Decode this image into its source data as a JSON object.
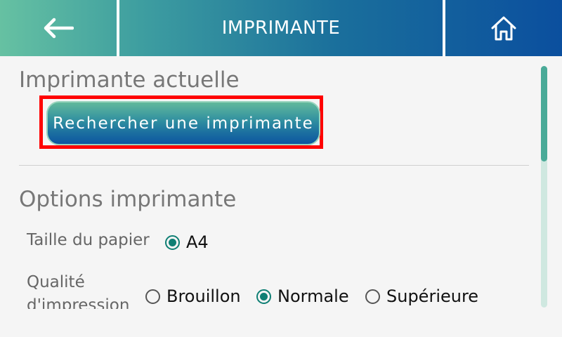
{
  "header": {
    "title": "IMPRIMANTE"
  },
  "current_printer": {
    "heading": "Imprimante actuelle",
    "search_button_label": "Rechercher une imprimante"
  },
  "options": {
    "heading": "Options imprimante",
    "paper_size": {
      "label": "Taille du papier",
      "options": [
        "A4"
      ],
      "selected": "A4"
    },
    "print_quality": {
      "label_line1": "Qualité",
      "label_line2": "d'impression",
      "options": [
        "Brouillon",
        "Normale",
        "Supérieure"
      ],
      "selected": "Normale"
    }
  },
  "icons": {
    "back": "arrow-left-icon",
    "home": "home-icon"
  },
  "colors": {
    "accent": "#0f7f74",
    "highlight": "#ff0000"
  }
}
